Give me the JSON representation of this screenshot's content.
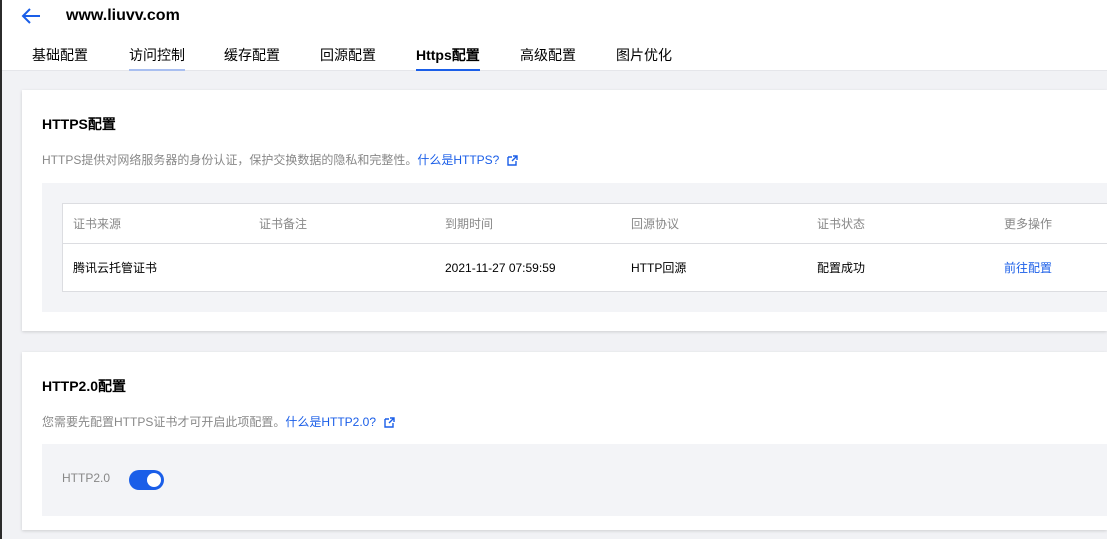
{
  "header": {
    "back_icon": "arrow-left-icon",
    "site": "www.liuvv.com"
  },
  "tabs": [
    {
      "label": "基础配置"
    },
    {
      "label": "访问控制"
    },
    {
      "label": "缓存配置"
    },
    {
      "label": "回源配置"
    },
    {
      "label": "Https配置"
    },
    {
      "label": "高级配置"
    },
    {
      "label": "图片优化"
    }
  ],
  "active_tab": "Https配置",
  "https_card": {
    "title": "HTTPS配置",
    "desc": "HTTPS提供对网络服务器的身份认证，保护交换数据的隐私和完整性。",
    "link": "什么是HTTPS?",
    "columns": [
      "证书来源",
      "证书备注",
      "到期时间",
      "回源协议",
      "证书状态",
      "更多操作"
    ],
    "row": {
      "source": "腾讯云托管证书",
      "note": "",
      "expire": "2021-11-27 07:59:59",
      "protocol": "HTTP回源",
      "status": "配置成功",
      "action": "前往配置"
    }
  },
  "http2_card": {
    "title": "HTTP2.0配置",
    "desc": "您需要先配置HTTPS证书才可开启此项配置。",
    "link": "什么是HTTP2.0?",
    "toggle_label": "HTTP2.0",
    "toggle_on": true
  },
  "colors": {
    "accent": "#1a5ee8",
    "muted_text": "#888888",
    "panel_bg": "#f3f4f7"
  }
}
